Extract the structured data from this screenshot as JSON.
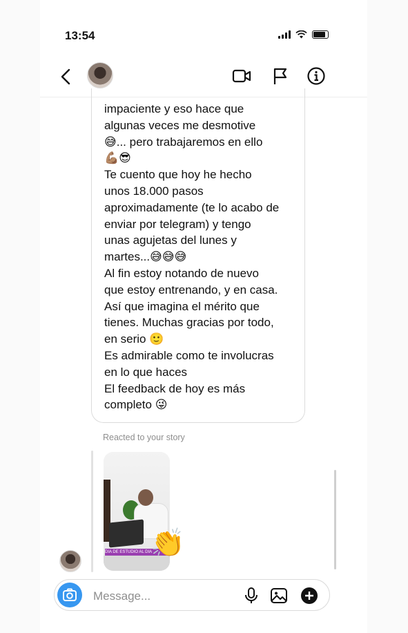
{
  "status_bar": {
    "time": "13:54"
  },
  "header": {
    "icons": [
      "back-icon",
      "video-call-icon",
      "flag-icon",
      "info-icon"
    ]
  },
  "message": {
    "lines": [
      "impaciente y eso hace que",
      "algunas veces me desmotive",
      "😅... pero trabajaremos en ello",
      "💪🏽😎",
      "Te cuento que hoy he hecho",
      "unos 18.000 pasos",
      "aproximadamente (te lo acabo de",
      "enviar por telegram) y tengo",
      "unas agujetas del lunes y",
      "martes...😅😅😅",
      "Al fin estoy notando de nuevo",
      "que estoy entrenando, y en casa.",
      "Así que imagina el mérito que",
      "tienes. Muchas gracias por todo,",
      "en serio 🙂",
      "Es admirable como te involucras",
      "en lo que haces",
      "El feedback de hoy es más",
      "completo 😜"
    ]
  },
  "story_reply": {
    "label": "Reacted to your story",
    "story_caption": "DIA DE ESTUDIO AL DIA",
    "reaction": "👏"
  },
  "composer": {
    "placeholder": "Message...",
    "icons": [
      "camera-icon",
      "microphone-icon",
      "gallery-icon",
      "add-icon"
    ]
  },
  "colors": {
    "accent": "#3797f0",
    "muted_text": "#8e8e8e",
    "bubble_border": "#dbdbdb"
  }
}
